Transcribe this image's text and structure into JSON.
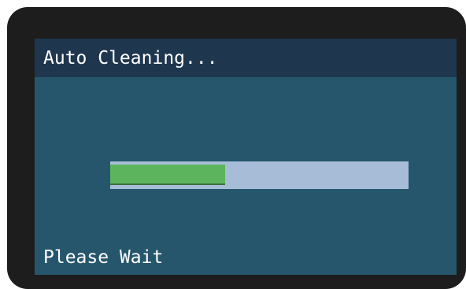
{
  "screen": {
    "title": "Auto Cleaning...",
    "status": "Please Wait"
  },
  "progress": {
    "fraction": 0.385
  },
  "colors": {
    "bezel": "#1d1d1d",
    "screen_background": "#26566c",
    "title_bar": "#1e374f",
    "progress_track": "#a7bdd7",
    "progress_fill": "#5cb55c",
    "text": "#ffffff"
  }
}
